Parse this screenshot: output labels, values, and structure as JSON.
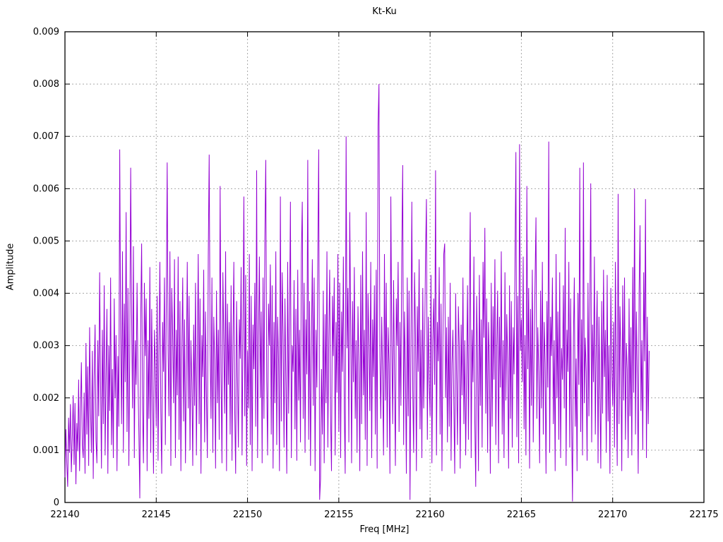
{
  "chart_data": {
    "type": "line",
    "title": "Kt-Ku",
    "xlabel": "Freq [MHz]",
    "ylabel": "Amplitude",
    "xlim": [
      22140,
      22175
    ],
    "ylim": [
      0,
      0.009
    ],
    "xtick_values": [
      22140,
      22145,
      22150,
      22155,
      22160,
      22165,
      22170,
      22175
    ],
    "xtick_labels": [
      "22140",
      "22145",
      "22150",
      "22155",
      "22160",
      "22165",
      "22170",
      "22175"
    ],
    "ytick_values": [
      0,
      0.001,
      0.002,
      0.003,
      0.004,
      0.005,
      0.006,
      0.007,
      0.008,
      0.009
    ],
    "ytick_labels": [
      "0",
      "0.001",
      "0.002",
      "0.003",
      "0.004",
      "0.005",
      "0.006",
      "0.007",
      "0.008",
      "0.009"
    ],
    "grid": true,
    "legend": "none",
    "line_color": "#9400d3",
    "grid_color": "#a9a9a9",
    "axis_color": "#000000",
    "series": [
      {
        "name": "Kt-Ku",
        "x_start": 22140,
        "x_step": 0.05,
        "n_points": 641,
        "y_scale": 1e-05,
        "y_e5": "48,140,75,30,162,95,188,58,120,205,72,190,35,152,98,235,60,170,268,110,85,210,55,305,130,260,70,335,180,95,290,45,240,340,120,75,310,165,440,230,65,330,150,415,90,245,370,55,300,175,430,110,255,85,390,200,320,60,280,145,675,320,150,480,95,380,230,555,135,410,70,290,640,365,180,490,85,310,225,420,240,130,8,350,495,180,75,420,280,390,60,310,160,450,95,370,215,55,330,260,145,395,80,300,460,175,55,345,250,430,110,375,650,290,165,480,70,410,320,190,465,85,330,205,470,120,385,60,290,430,155,350,75,255,460,180,395,100,310,230,70,340,185,420,90,280,475,150,390,55,320,240,445,115,365,205,85,470,665,300,160,430,95,355,270,65,405,190,330,120,605,250,75,440,310,170,480,60,380,225,345,130,415,80,295,460,175,55,385,240,105,350,275,450,90,320,585,165,435,70,290,180,475,110,395,60,340,255,420,145,635,85,310,470,200,365,75,430,160,505,655,235,90,380,300,455,130,415,65,345,190,480,110,355,270,60,585,155,440,320,105,390,230,55,460,170,335,575,85,300,250,425,140,370,80,445,195,330,115,475,575,160,420,95,350,245,655,120,385,70,300,465,185,430,60,330,220,470,675,5,45,255,130,405,75,360,190,480,105,315,445,165,60,395,280,430,90,345,210,475,135,420,85,365,250,470,180,55,700,295,410,115,555,340,75,385,230,450,160,310,95,375,265,60,435,150,480,205,330,120,555,70,400,310,175,460,85,350,240,415,130,445,65,720,800,280,160,355,240,90,475,195,420,105,335,265,55,585,310,150,425,240,70,390,300,460,135,345,185,480,645,110,365,255,55,430,165,405,5,290,575,215,95,440,320,60,375,250,465,140,330,85,410,180,300,470,580,120,355,235,165,435,75,310,390,225,635,90,345,270,450,130,380,60,295,475,495,200,335,115,355,145,420,80,265,330,190,55,400,240,110,375,295,65,340,205,430,150,310,90,250,415,120,365,555,85,330,230,470,155,30,395,275,60,435,185,350,105,460,315,525,170,390,95,345,265,55,420,145,375,235,465,110,300,405,75,355,220,480,130,310,85,440,195,360,270,65,415,160,385,105,335,245,455,670,125,395,75,685,290,350,230,470,140,320,90,605,255,410,65,370,185,445,115,300,425,545,160,335,250,75,405,180,460,130,345,265,55,385,220,690,95,355,280,430,150,310,60,475,200,365,120,440,85,295,235,415,180,525,70,330,250,460,105,390,160,2,310,430,145,275,60,400,225,640,135,350,90,650,190,315,250,80,420,165,370,610,115,340,230,470,130,295,405,75,355,215,65,385,170,445,240,330,95,435,155,300,55,410,260,185,345,105,460,235,70,590,150,375,280,60,415,195,430,120,305,255,85,390,165,335,90,450,210,600,130,365,245,55,405,530,175,310,100,440,270,580,85,355,150,290"
      }
    ]
  }
}
